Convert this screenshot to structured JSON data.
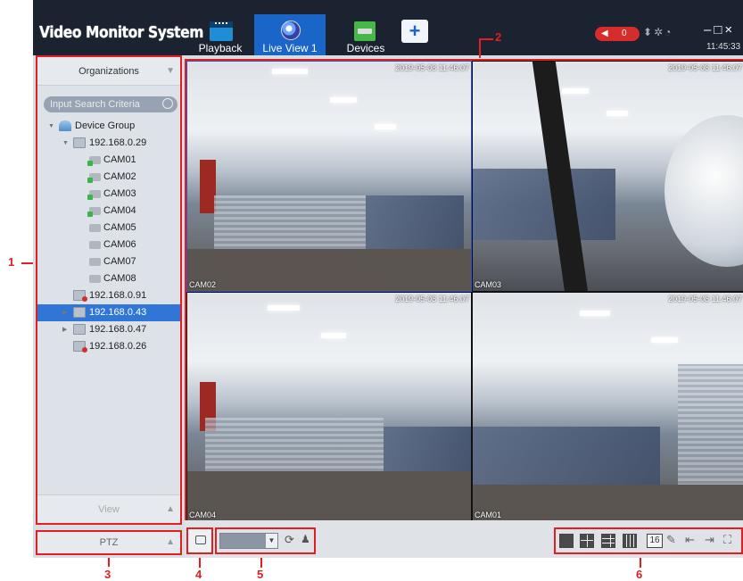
{
  "header": {
    "app_title": "Video Monitor System",
    "tabs": [
      {
        "label": "Playback",
        "icon": "playback-icon"
      },
      {
        "label": "Live View 1",
        "icon": "live-view-icon",
        "active": true
      },
      {
        "label": "Devices",
        "icon": "devices-icon"
      }
    ],
    "add_tab_icon": "plus-icon",
    "alarm_count": "0",
    "clock": "11:45:33",
    "window_controls": [
      "minimize",
      "maximize",
      "close"
    ]
  },
  "sidebar": {
    "section_title": "Organizations",
    "search_placeholder": "Input Search Criteria",
    "tree": [
      {
        "label": "Device Group",
        "type": "group",
        "level": 0
      },
      {
        "label": "192.168.0.29",
        "type": "nvr",
        "level": 1,
        "expanded": true
      },
      {
        "label": "CAM01",
        "type": "camera",
        "level": 2,
        "online": true
      },
      {
        "label": "CAM02",
        "type": "camera",
        "level": 2,
        "online": true
      },
      {
        "label": "CAM03",
        "type": "camera",
        "level": 2,
        "online": true
      },
      {
        "label": "CAM04",
        "type": "camera",
        "level": 2,
        "online": true
      },
      {
        "label": "CAM05",
        "type": "camera",
        "level": 2,
        "online": false
      },
      {
        "label": "CAM06",
        "type": "camera",
        "level": 2,
        "online": false
      },
      {
        "label": "CAM07",
        "type": "camera",
        "level": 2,
        "online": false
      },
      {
        "label": "CAM08",
        "type": "camera",
        "level": 2,
        "online": false
      },
      {
        "label": "192.168.0.91",
        "type": "nvr",
        "level": 1,
        "offline": true
      },
      {
        "label": "192.168.0.43",
        "type": "nvr",
        "level": 1,
        "selected": true
      },
      {
        "label": "192.168.0.47",
        "type": "nvr",
        "level": 1
      },
      {
        "label": "192.168.0.26",
        "type": "nvr",
        "level": 1,
        "offline": true
      }
    ],
    "view_label": "View",
    "ptz_label": "PTZ"
  },
  "video": {
    "cells": [
      {
        "name": "CAM02",
        "timestamp": "2019-05-08 11:46:07",
        "active": true
      },
      {
        "name": "CAM03",
        "timestamp": "2019-05-08 11:46:07"
      },
      {
        "name": "CAM04",
        "timestamp": "2019-05-08 11:46:07"
      },
      {
        "name": "CAM01",
        "timestamp": "2019-05-08 11:46:07"
      }
    ]
  },
  "toolbar": {
    "layout_16_label": "16"
  },
  "annotations": [
    "1",
    "2",
    "3",
    "4",
    "5",
    "6"
  ],
  "colors": {
    "accent": "#1a66c8",
    "annotation": "#e02020",
    "header_bg": "#1b2230",
    "alarm": "#d62c2c"
  }
}
